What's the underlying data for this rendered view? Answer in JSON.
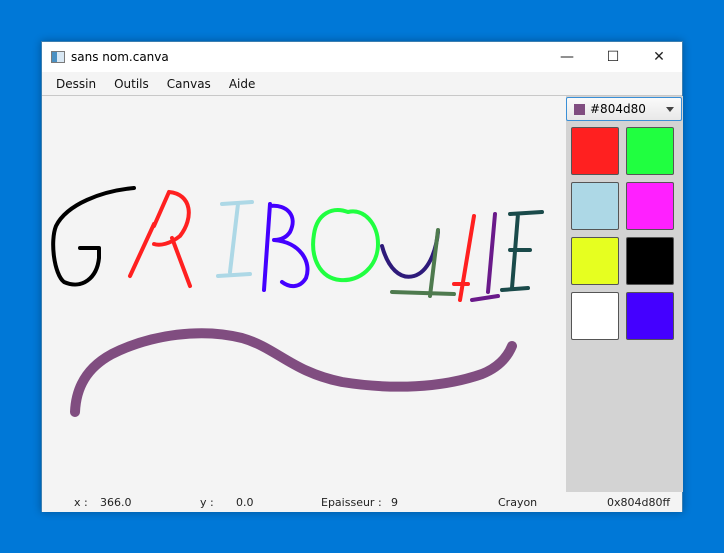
{
  "window": {
    "title": "sans nom.canva",
    "controls": {
      "minimize": "—",
      "maximize": "☐",
      "close": "✕"
    }
  },
  "menu": [
    "Dessin",
    "Outils",
    "Canvas",
    "Aide"
  ],
  "palette": {
    "selected_label": "#804d80",
    "selected_color": "#804d80",
    "swatches": [
      "#ff2020",
      "#20ff40",
      "#add8e6",
      "#ff20ff",
      "#e6ff20",
      "#000000",
      "#ffffff",
      "#4400ff"
    ]
  },
  "status": {
    "x_label": "x :",
    "x_value": "366.0",
    "y_label": "y :",
    "y_value": "0.0",
    "thickness_label": "Epaisseur :",
    "thickness_value": "9",
    "tool": "Crayon",
    "color_hex": "0x804d80ff"
  },
  "drawing": {
    "stroke_colors": [
      "#000000",
      "#ff2020",
      "#add8e6",
      "#4400ff",
      "#20ff40",
      "#2e1a7a",
      "#4e7a4e",
      "#ff2020",
      "#6a1a8a",
      "#1a4a4a",
      "#804d80"
    ]
  }
}
